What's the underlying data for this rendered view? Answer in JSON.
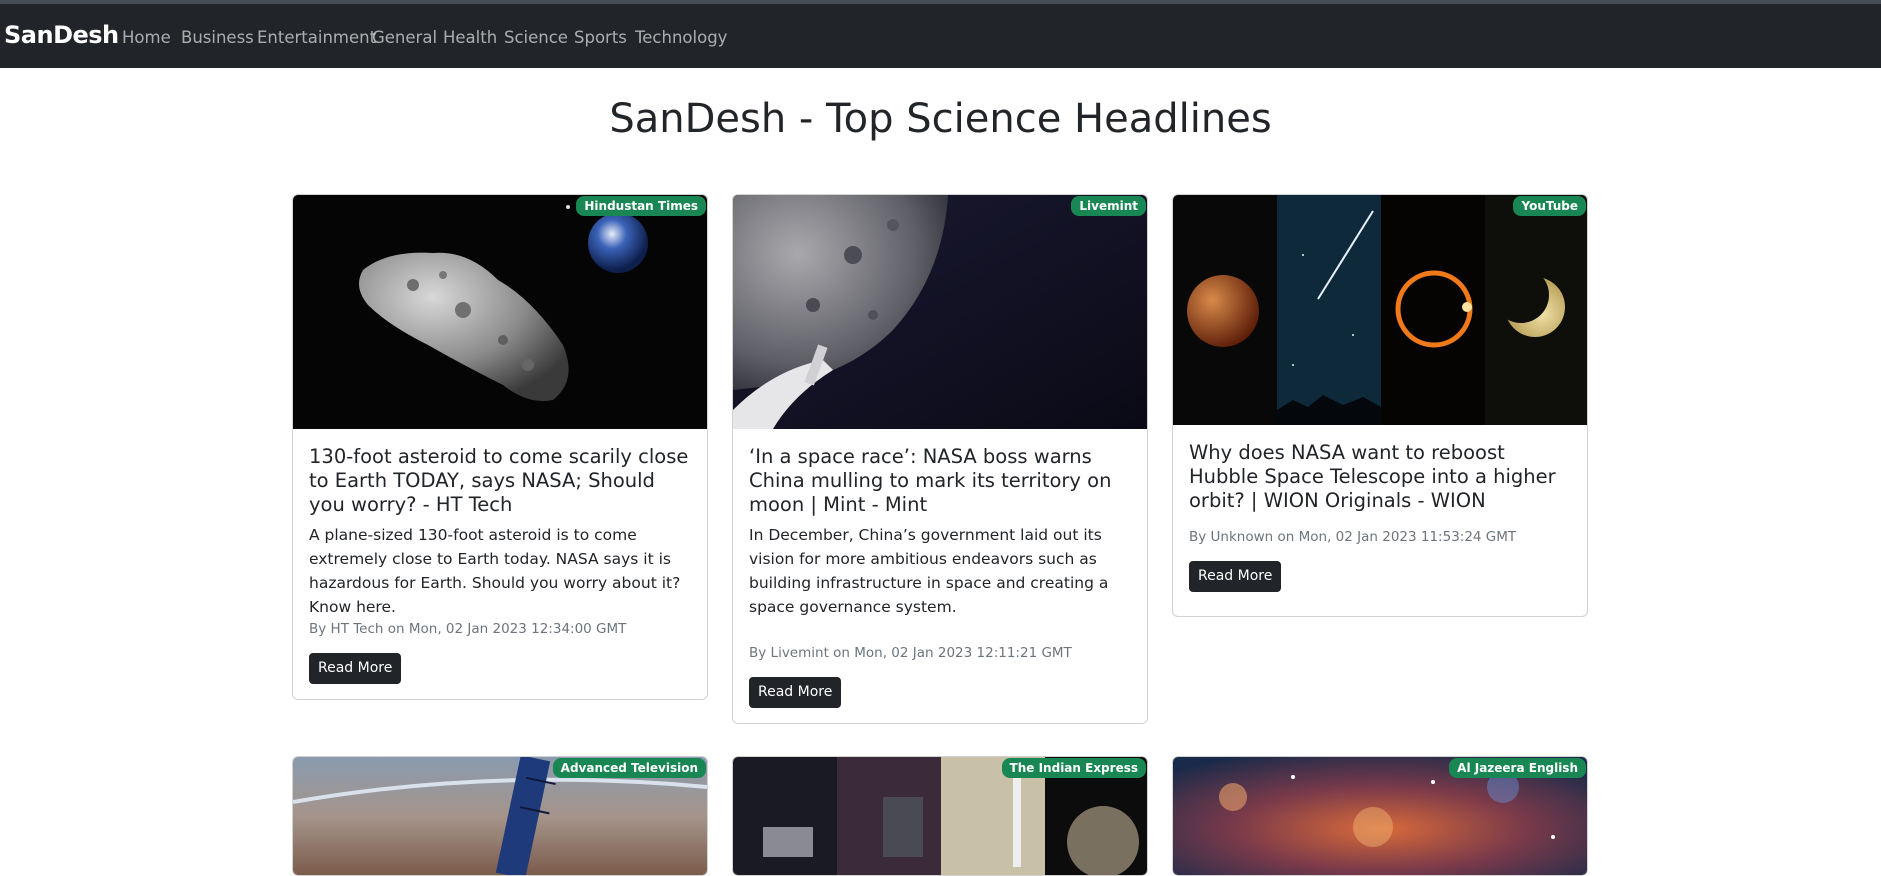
{
  "nav": {
    "brand": "SanDesh",
    "links": [
      "Home",
      "Business",
      "Entertainment",
      "General",
      "Health",
      "Science",
      "Sports",
      "Technology"
    ]
  },
  "page_title": "SanDesh - Top Science Headlines",
  "colors": {
    "navbar": "#212529",
    "badge": "#198754",
    "button": "#212529"
  },
  "cards": [
    {
      "source": "Hindustan Times",
      "title": "130-foot asteroid to come scarily close to Earth TODAY, says NASA; Should you worry? - HT Tech",
      "description": "A plane-sized 130-foot asteroid is to come extremely close to Earth today. NASA says it is hazardous for Earth. Should you worry about it? Know here.",
      "meta": "By HT Tech on Mon, 02 Jan 2023 12:34:00 GMT",
      "button": "Read More",
      "image": "asteroid-earth-image"
    },
    {
      "source": "Livemint",
      "title": "‘In a space race’: NASA boss warns China mulling to mark its territory on moon | Mint - Mint",
      "description": "In December, China’s government laid out its vision for more ambitious endeavors such as building infrastructure in space and creating a space governance system.",
      "meta": "By Livemint on Mon, 02 Jan 2023 12:11:21 GMT",
      "button": "Read More",
      "image": "moon-spacecraft-image"
    },
    {
      "source": "YouTube",
      "title": "Why does NASA want to reboost Hubble Space Telescope into a higher orbit? | WION Originals - WION",
      "description": "",
      "meta": "By Unknown on Mon, 02 Jan 2023 11:53:24 GMT",
      "button": "Read More",
      "image": "celestial-events-image"
    },
    {
      "source": "Advanced Television",
      "image": "satellite-earth-image"
    },
    {
      "source": "The Indian Express",
      "image": "spacecraft-collage-image"
    },
    {
      "source": "Al Jazeera English",
      "image": "nebula-image"
    }
  ]
}
